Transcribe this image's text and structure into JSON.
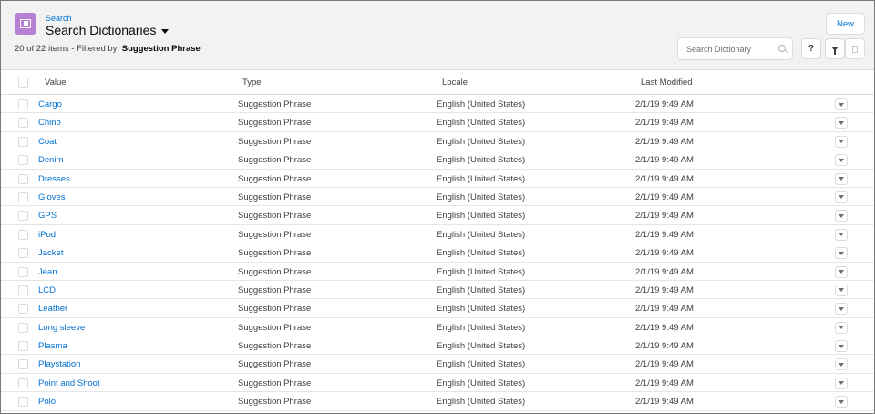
{
  "header": {
    "breadcrumb": "Search",
    "title": "Search Dictionaries",
    "subtitle_prefix": "20 of 22 items - Filtered by: ",
    "subtitle_filter": "Suggestion Phrase",
    "new_label": "New",
    "search_placeholder": "Search Dictionary",
    "help_label": "?"
  },
  "columns": {
    "value": "Value",
    "type": "Type",
    "locale": "Locale",
    "modified": "Last Modified"
  },
  "rows": [
    {
      "value": "Cargo",
      "type": "Suggestion Phrase",
      "locale": "English (United States)",
      "modified": "2/1/19 9:49 AM"
    },
    {
      "value": "Chino",
      "type": "Suggestion Phrase",
      "locale": "English (United States)",
      "modified": "2/1/19 9:49 AM"
    },
    {
      "value": "Coat",
      "type": "Suggestion Phrase",
      "locale": "English (United States)",
      "modified": "2/1/19 9:49 AM"
    },
    {
      "value": "Denim",
      "type": "Suggestion Phrase",
      "locale": "English (United States)",
      "modified": "2/1/19 9:49 AM"
    },
    {
      "value": "Dresses",
      "type": "Suggestion Phrase",
      "locale": "English (United States)",
      "modified": "2/1/19 9:49 AM"
    },
    {
      "value": "Gloves",
      "type": "Suggestion Phrase",
      "locale": "English (United States)",
      "modified": "2/1/19 9:49 AM"
    },
    {
      "value": "GPS",
      "type": "Suggestion Phrase",
      "locale": "English (United States)",
      "modified": "2/1/19 9:49 AM"
    },
    {
      "value": "iPod",
      "type": "Suggestion Phrase",
      "locale": "English (United States)",
      "modified": "2/1/19 9:49 AM"
    },
    {
      "value": "Jacket",
      "type": "Suggestion Phrase",
      "locale": "English (United States)",
      "modified": "2/1/19 9:49 AM"
    },
    {
      "value": "Jean",
      "type": "Suggestion Phrase",
      "locale": "English (United States)",
      "modified": "2/1/19 9:49 AM"
    },
    {
      "value": "LCD",
      "type": "Suggestion Phrase",
      "locale": "English (United States)",
      "modified": "2/1/19 9:49 AM"
    },
    {
      "value": "Leather",
      "type": "Suggestion Phrase",
      "locale": "English (United States)",
      "modified": "2/1/19 9:49 AM"
    },
    {
      "value": "Long sleeve",
      "type": "Suggestion Phrase",
      "locale": "English (United States)",
      "modified": "2/1/19 9:49 AM"
    },
    {
      "value": "Plasma",
      "type": "Suggestion Phrase",
      "locale": "English (United States)",
      "modified": "2/1/19 9:49 AM"
    },
    {
      "value": "Playstation",
      "type": "Suggestion Phrase",
      "locale": "English (United States)",
      "modified": "2/1/19 9:49 AM"
    },
    {
      "value": "Point and Shoot",
      "type": "Suggestion Phrase",
      "locale": "English (United States)",
      "modified": "2/1/19 9:49 AM"
    },
    {
      "value": "Polo",
      "type": "Suggestion Phrase",
      "locale": "English (United States)",
      "modified": "2/1/19 9:49 AM"
    }
  ],
  "icons": {
    "object": "dictionary-icon",
    "title_menu": "chevron-down-icon",
    "search": "search-icon",
    "filter": "filter-icon",
    "delete": "trash-icon",
    "row_menu": "chevron-down-icon"
  },
  "colors": {
    "link": "#0070d2",
    "header_bg": "#f3f2f2",
    "object_icon": "#b781d3"
  }
}
